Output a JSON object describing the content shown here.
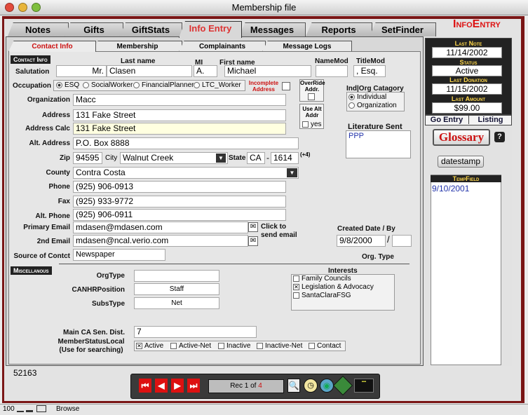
{
  "window": {
    "title": "Membership file"
  },
  "brand": "InfoEntry",
  "tabs": [
    "Notes",
    "Gifts",
    "GiftStats",
    "Info Entry",
    "Messages",
    "Reports",
    "SetFinder"
  ],
  "subtabs": [
    "Contact Info",
    "Membership",
    "Complainants",
    "Message Logs"
  ],
  "section_contact": "Contact Info",
  "section_misc": "Miscellanous",
  "labels": {
    "salutation": "Salutation",
    "last_name": "Last name",
    "mi": "MI",
    "first_name": "First name",
    "name_mod": "NameMod",
    "title_mod": "TitleMod",
    "occupation": "Occupation",
    "organization": "Organization",
    "address": "Address",
    "address_calc": "Address Calc",
    "alt_address": "Alt. Address",
    "zip": "Zip",
    "city": "City",
    "state": "State",
    "county": "County",
    "phone": "Phone",
    "fax": "Fax",
    "alt_phone": "Alt. Phone",
    "primary_email": "Primary Email",
    "second_email": "2nd Email",
    "source": "Source of Contct",
    "click_to_send": "Click to send email",
    "created_date": "Created Date / By",
    "org_type": "Org. Type",
    "ind_org_category": "Ind|Org Catagory",
    "literature_sent": "Literature Sent",
    "incomplete_address": "Incomplete Address",
    "override_addr": "OverRide Addr.",
    "use_alt_addr": "Use Alt Addr",
    "plus4": "(+4)",
    "misc_orgtype": "OrgType",
    "misc_canhr": "CANHRPosition",
    "misc_substype": "SubsType",
    "interests": "Interests",
    "main_ca_sen": "Main CA Sen. Dist.",
    "member_status": "MemberStatusLocal",
    "member_status_hint": "(Use for searching)"
  },
  "fields": {
    "salutation": "Mr.",
    "last_name": "Clasen",
    "mi": "A.",
    "first_name": "Michael",
    "name_mod": "",
    "title_mod": ", Esq.",
    "organization": "Macc",
    "address": "131 Fake Street",
    "address_calc": "131 Fake Street",
    "alt_address": "P.O. Box 8888",
    "zip": "94595",
    "city": "Walnut Creek",
    "state": "CA",
    "zip4": "1614",
    "county": "Contra Costa",
    "phone": "(925) 906-0913",
    "fax": "(925) 933-9772",
    "alt_phone": "(925) 906-0911",
    "primary_email": "mdasen@mdasen.com",
    "second_email": "mdasen@ncal.verio.com",
    "source": "Newspaper",
    "created_date": "9/8/2000",
    "created_by": "",
    "literature_sent": "PPP",
    "misc_orgtype": "",
    "misc_canhr": "Staff",
    "misc_substype": "Net",
    "main_ca_sen": "7",
    "use_alt_yes": "yes"
  },
  "occupation_options": [
    {
      "label": "ESQ",
      "selected": true
    },
    {
      "label": "SocialWorker",
      "selected": false
    },
    {
      "label": "FinancialPlanner",
      "selected": false
    },
    {
      "label": "LTC_Worker",
      "selected": false
    }
  ],
  "ind_org_options": [
    {
      "label": "Individual",
      "selected": true
    },
    {
      "label": "Organization",
      "selected": false
    }
  ],
  "interests": [
    {
      "label": "Family Councils",
      "checked": false
    },
    {
      "label": "Legislation & Advocacy",
      "checked": true
    },
    {
      "label": "SantaClaraFSG",
      "checked": false
    }
  ],
  "member_status_options": [
    {
      "label": "Active",
      "checked": true
    },
    {
      "label": "Active-Net",
      "checked": false
    },
    {
      "label": "Inactive",
      "checked": false
    },
    {
      "label": "Inactive-Net",
      "checked": false
    },
    {
      "label": "Contact",
      "checked": false
    }
  ],
  "sidebar": {
    "last_note_label": "Last Note",
    "last_note": "11/14/2002",
    "status_label": "Status",
    "status": "Active",
    "last_donation_label": "Last Donation",
    "last_donation": "11/15/2002",
    "last_amount_label": "Last Amount",
    "last_amount": "$99.00",
    "go_entry": "Go Entry",
    "listing": "Listing",
    "glossary": "Glossary",
    "datestamp": "datestamp",
    "tempfield_label": "TempField",
    "tempfield": "9/10/2001"
  },
  "record_id": "52163",
  "nav": {
    "rec_prefix": "Rec",
    "rec_current": "1",
    "rec_of": "of",
    "rec_total": "4"
  },
  "statusbar": {
    "zoom": "100",
    "mode": "Browse"
  },
  "colors": {
    "frame": "#7a1616",
    "accent_red": "#d11111",
    "gold": "#ffd84a"
  }
}
